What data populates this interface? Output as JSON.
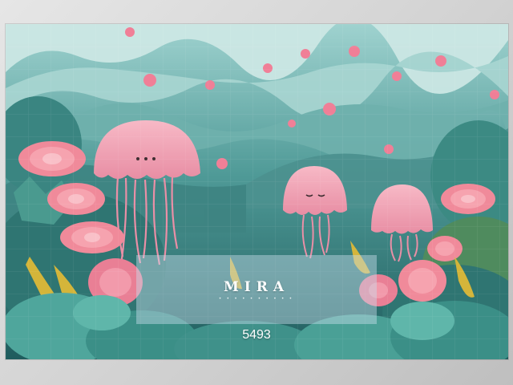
{
  "watermark": {
    "brand": "MIRA",
    "dots": "• • • • • • • • • •"
  },
  "caption": {
    "code": "5493"
  },
  "colors": {
    "water_light": "#b4ddd8",
    "water_dark": "#2a6d6c",
    "jellyfish_pink": "#f2a0b4",
    "flower_pink": "#f08a9a",
    "foliage_teal": "#3c8c86",
    "foliage_yellow": "#d4b53a"
  }
}
